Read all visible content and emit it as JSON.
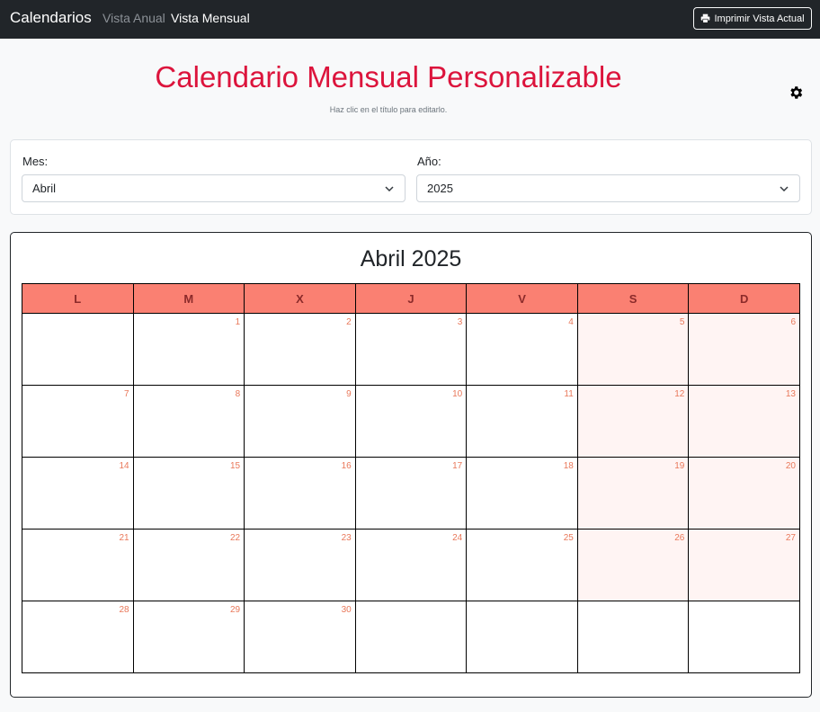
{
  "navbar": {
    "brand": "Calendarios",
    "links": [
      "Vista Anual",
      "Vista Mensual"
    ],
    "print_label": "Imprimir Vista Actual"
  },
  "header": {
    "title": "Calendario Mensual Personalizable",
    "subtitle": "Haz clic en el título para editarlo."
  },
  "selectors": {
    "month_label": "Mes:",
    "month_value": "Abril",
    "year_label": "Año:",
    "year_value": "2025"
  },
  "calendar": {
    "title": "Abril 2025",
    "weekdays": [
      "L",
      "M",
      "X",
      "J",
      "V",
      "S",
      "D"
    ],
    "weeks": [
      [
        "",
        "1",
        "2",
        "3",
        "4",
        "5",
        "6"
      ],
      [
        "7",
        "8",
        "9",
        "10",
        "11",
        "12",
        "13"
      ],
      [
        "14",
        "15",
        "16",
        "17",
        "18",
        "19",
        "20"
      ],
      [
        "21",
        "22",
        "23",
        "24",
        "25",
        "26",
        "27"
      ],
      [
        "28",
        "29",
        "30",
        "",
        "",
        "",
        ""
      ]
    ]
  },
  "colors": {
    "accent": "#dc143c",
    "header_bg": "#fa8072",
    "weekend_bg": "#fff4f3",
    "day_number": "#e9785a"
  }
}
